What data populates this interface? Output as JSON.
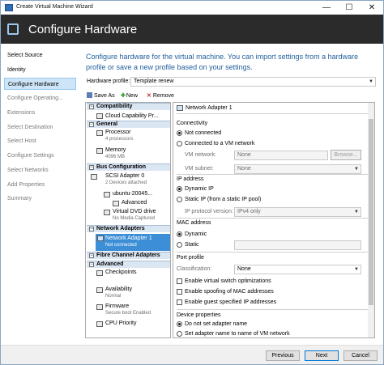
{
  "window": {
    "title": "Create Virtual Machine Wizard",
    "minimize": "—",
    "maximize": "☐",
    "close": "✕"
  },
  "banner": {
    "title": "Configure Hardware"
  },
  "nav": {
    "items": [
      {
        "label": "Select Source",
        "state": "normal"
      },
      {
        "label": "Identity",
        "state": "normal"
      },
      {
        "label": "Configure Hardware",
        "state": "selected"
      },
      {
        "label": "Configure Operating...",
        "state": "disabled"
      },
      {
        "label": "Extensions",
        "state": "disabled"
      },
      {
        "label": "Select Destination",
        "state": "disabled"
      },
      {
        "label": "Select Host",
        "state": "disabled"
      },
      {
        "label": "Configure Settings",
        "state": "disabled"
      },
      {
        "label": "Select Networks",
        "state": "disabled"
      },
      {
        "label": "Add Properties",
        "state": "disabled"
      },
      {
        "label": "Summary",
        "state": "disabled"
      }
    ]
  },
  "description": "Configure hardware for the virtual machine. You can import settings from a hardware profile or save a new profile based on your settings.",
  "hardware_profile": {
    "label": "Hardware profile:",
    "value": "Template renew"
  },
  "toolbar": {
    "save_as": "Save As",
    "new": "New",
    "remove": "Remove"
  },
  "tree": {
    "compatibility": "Compatibility",
    "cloud_capability": "Cloud Capability Pr...",
    "general": "General",
    "processor": "Processor",
    "processor_sub": "4 processors",
    "memory": "Memory",
    "memory_sub": "4096 MB",
    "bus_configuration": "Bus Configuration",
    "scsi": "SCSI Adapter 0",
    "scsi_sub": "2 Devices attached",
    "disk": "ubuntu-20045...",
    "disk_advanced": "Advanced",
    "dvd": "Virtual DVD drive",
    "dvd_sub": "No Media Captured",
    "network_adapters": "Network Adapters",
    "net_adapter": "Network Adapter 1",
    "net_adapter_sub": "Not connected",
    "fibre_channel": "Fibre Channel Adapters",
    "advanced": "Advanced",
    "checkpoints": "Checkpoints",
    "availability": "Availability",
    "availability_sub": "Normal",
    "firmware": "Firmware",
    "firmware_sub": "Secure boot Enabled",
    "cpu_priority": "CPU Priority"
  },
  "detail": {
    "header": "Network Adapter 1",
    "connectivity": "Connectivity",
    "not_connected": "Not connected",
    "connected_vm_network": "Connected to a VM network",
    "vm_network_label": "VM network:",
    "vm_network_value": "None",
    "browse": "Browse...",
    "vm_subnet_label": "VM subnet:",
    "vm_subnet_value": "None",
    "ip_address": "IP address",
    "dynamic_ip": "Dynamic IP",
    "static_ip": "Static IP (from a static IP pool)",
    "ip_protocol_label": "IP protocol version:",
    "ip_protocol_value": "IPv4 only",
    "mac_address": "MAC address",
    "mac_dynamic": "Dynamic",
    "mac_static": "Static",
    "port_profile": "Port profile",
    "classification_label": "Classification:",
    "classification_value": "None",
    "enable_vswitch": "Enable virtual switch optimizations",
    "enable_spoofing": "Enable spoofing of MAC addresses",
    "enable_guest_ip": "Enable guest specified IP addresses",
    "device_properties": "Device properties",
    "no_adapter_name": "Do not set adapter name",
    "set_adapter_name": "Set adapter name to name of VM network"
  },
  "footer": {
    "previous": "Previous",
    "next": "Next",
    "cancel": "Cancel"
  },
  "colors": {
    "banner": "#2b2b2b",
    "accent": "#3c8fd6",
    "description": "#1e5e9d"
  }
}
